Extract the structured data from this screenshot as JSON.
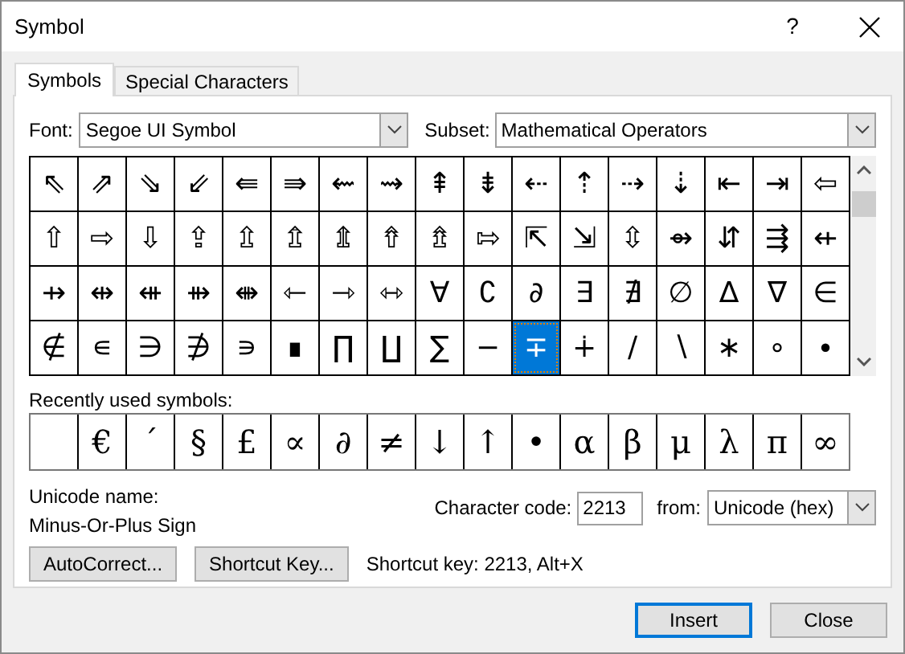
{
  "window": {
    "title": "Symbol",
    "help": "?"
  },
  "tabs": [
    {
      "label": "Symbols",
      "selected": true
    },
    {
      "label": "Special Characters",
      "selected": false
    }
  ],
  "font": {
    "label": "Font:",
    "value": "Segoe UI Symbol"
  },
  "subset": {
    "label": "Subset:",
    "value": "Mathematical Operators"
  },
  "symbol_grid": [
    [
      {
        "char": "⇖",
        "selected": false
      },
      {
        "char": "⇗",
        "selected": false
      },
      {
        "char": "⇘",
        "selected": false
      },
      {
        "char": "⇙",
        "selected": false
      },
      {
        "char": "⇚",
        "selected": false
      },
      {
        "char": "⇛",
        "selected": false
      },
      {
        "char": "⇜",
        "selected": false
      },
      {
        "char": "⇝",
        "selected": false
      },
      {
        "char": "⇞",
        "selected": false
      },
      {
        "char": "⇟",
        "selected": false
      },
      {
        "char": "⇠",
        "selected": false
      },
      {
        "char": "⇡",
        "selected": false
      },
      {
        "char": "⇢",
        "selected": false
      },
      {
        "char": "⇣",
        "selected": false
      },
      {
        "char": "⇤",
        "selected": false
      },
      {
        "char": "⇥",
        "selected": false
      },
      {
        "char": "⇦",
        "selected": false
      }
    ],
    [
      {
        "char": "⇧",
        "selected": false
      },
      {
        "char": "⇨",
        "selected": false
      },
      {
        "char": "⇩",
        "selected": false
      },
      {
        "char": "⇪",
        "selected": false
      },
      {
        "char": "⇫",
        "selected": false
      },
      {
        "char": "⇬",
        "selected": false
      },
      {
        "char": "⇭",
        "selected": false
      },
      {
        "char": "⇮",
        "selected": false
      },
      {
        "char": "⇯",
        "selected": false
      },
      {
        "char": "⇰",
        "selected": false
      },
      {
        "char": "⇱",
        "selected": false
      },
      {
        "char": "⇲",
        "selected": false
      },
      {
        "char": "⇳",
        "selected": false
      },
      {
        "char": "⇴",
        "selected": false
      },
      {
        "char": "⇵",
        "selected": false
      },
      {
        "char": "⇶",
        "selected": false
      },
      {
        "char": "⇷",
        "selected": false
      }
    ],
    [
      {
        "char": "⇸",
        "selected": false
      },
      {
        "char": "⇹",
        "selected": false
      },
      {
        "char": "⇺",
        "selected": false
      },
      {
        "char": "⇻",
        "selected": false
      },
      {
        "char": "⇼",
        "selected": false
      },
      {
        "char": "⇽",
        "selected": false
      },
      {
        "char": "⇾",
        "selected": false
      },
      {
        "char": "⇿",
        "selected": false
      },
      {
        "char": "∀",
        "selected": false
      },
      {
        "char": "∁",
        "selected": false
      },
      {
        "char": "∂",
        "selected": false
      },
      {
        "char": "∃",
        "selected": false
      },
      {
        "char": "∄",
        "selected": false
      },
      {
        "char": "∅",
        "selected": false
      },
      {
        "char": "∆",
        "selected": false
      },
      {
        "char": "∇",
        "selected": false
      },
      {
        "char": "∈",
        "selected": false
      }
    ],
    [
      {
        "char": "∉",
        "selected": false
      },
      {
        "char": "∊",
        "selected": false
      },
      {
        "char": "∋",
        "selected": false
      },
      {
        "char": "∌",
        "selected": false
      },
      {
        "char": "∍",
        "selected": false
      },
      {
        "char": "∎",
        "selected": false
      },
      {
        "char": "∏",
        "selected": false
      },
      {
        "char": "∐",
        "selected": false
      },
      {
        "char": "∑",
        "selected": false
      },
      {
        "char": "−",
        "selected": false
      },
      {
        "char": "∓",
        "selected": true
      },
      {
        "char": "∔",
        "selected": false
      },
      {
        "char": "∕",
        "selected": false
      },
      {
        "char": "∖",
        "selected": false
      },
      {
        "char": "∗",
        "selected": false
      },
      {
        "char": "∘",
        "selected": false
      },
      {
        "char": "∙",
        "selected": false
      }
    ]
  ],
  "recent": {
    "label": "Recently used symbols:",
    "symbols": [
      "€",
      "´",
      "§",
      "£",
      "∝",
      "∂",
      "≠",
      "↓",
      "↑",
      "•",
      "α",
      "β",
      "μ",
      "λ",
      "π",
      "∞"
    ]
  },
  "unicode_name": {
    "label": "Unicode name:",
    "value": "Minus-Or-Plus Sign"
  },
  "character_code": {
    "label": "Character code:",
    "value": "2213"
  },
  "from": {
    "label": "from:",
    "value": "Unicode (hex)"
  },
  "buttons": [
    "AutoCorrect...",
    "Shortcut Key..."
  ],
  "shortcut_text": "Shortcut key: 2213, Alt+X",
  "footer_buttons": [
    {
      "label": "Insert",
      "default": true
    },
    {
      "label": "Close",
      "default": false
    }
  ]
}
